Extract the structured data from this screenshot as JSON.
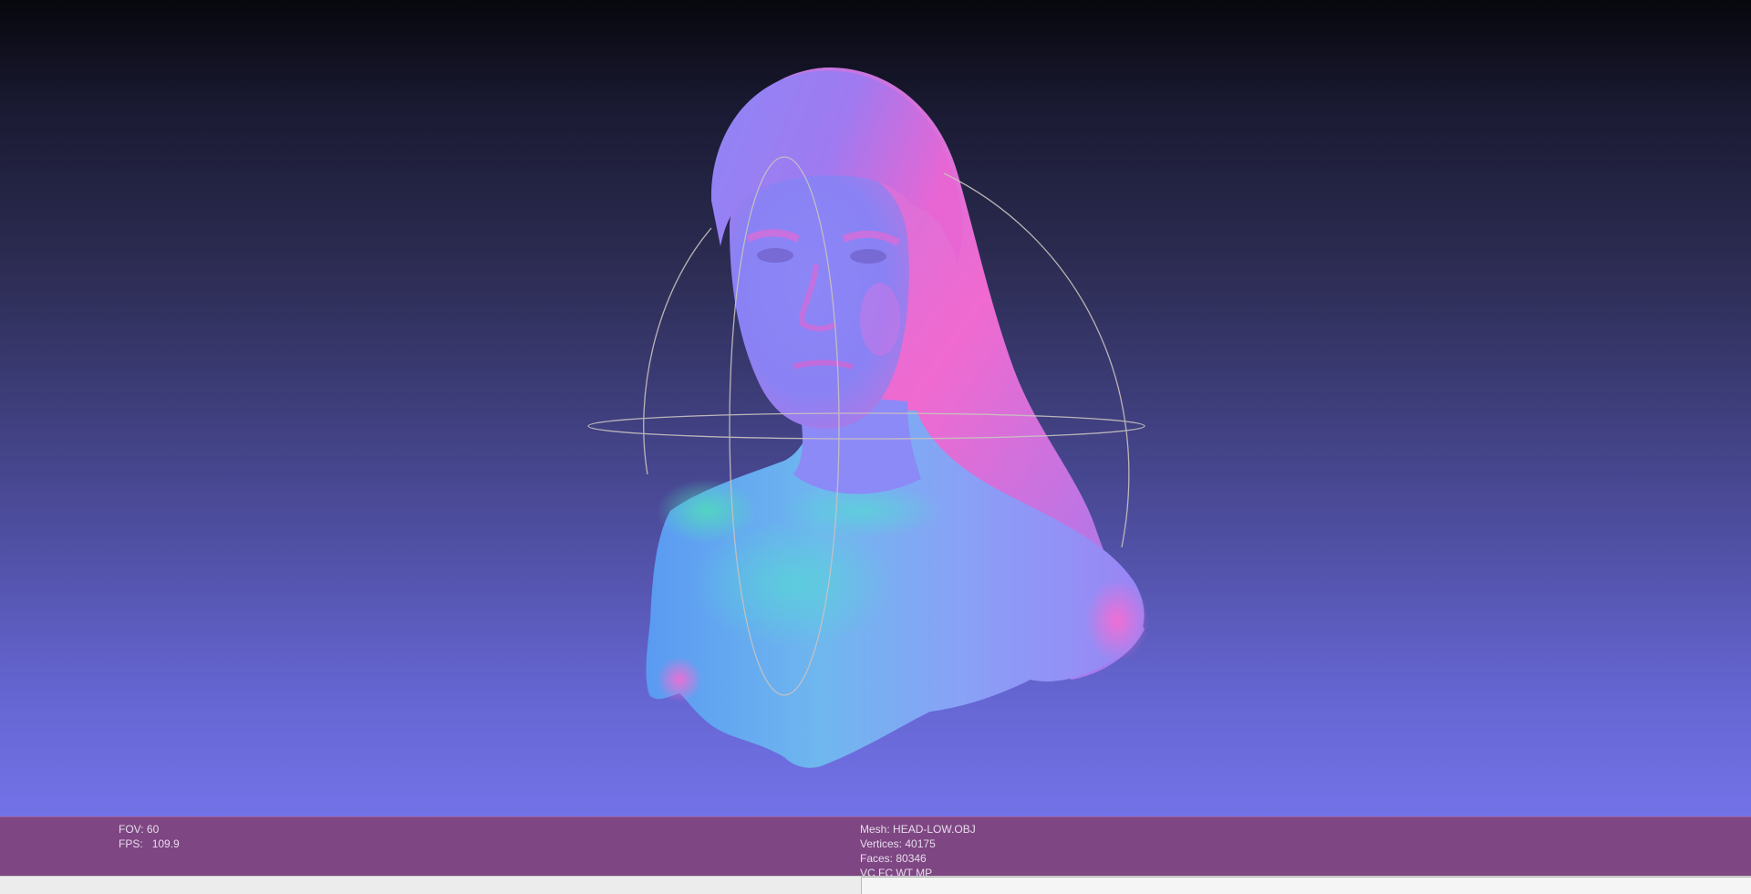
{
  "overlay": {
    "left": {
      "fov_label": "FOV:",
      "fov_value": "60",
      "fps_label": "FPS:",
      "fps_value": "109.9"
    },
    "right": {
      "mesh_label": "Mesh:",
      "mesh_value": "HEAD-LOW.OBJ",
      "vertices_label": "Vertices:",
      "vertices_value": "40175",
      "faces_label": "Faces:",
      "faces_value": "80346",
      "flags": "VC FC WT MP"
    }
  },
  "colors": {
    "info_bar": "#7e4682",
    "background_top": "#07070d",
    "background_bottom": "#7373e8",
    "trackball": "#c9c2c0"
  },
  "scene": {
    "model": "normal-shaded-head-bust",
    "gizmo": "trackball-icon"
  }
}
